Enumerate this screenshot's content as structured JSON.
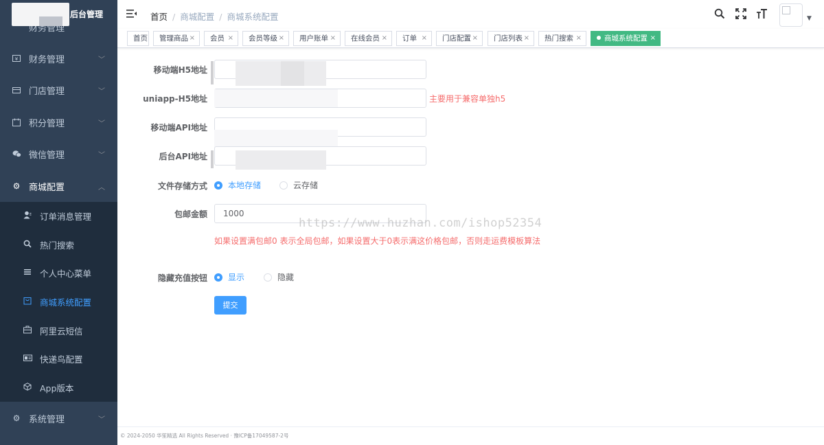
{
  "brand": {
    "title": "后台管理"
  },
  "sidebar": {
    "partial_item": "财务管理",
    "menus": [
      {
        "label": "财务管理",
        "icon": "finance-icon"
      },
      {
        "label": "门店管理",
        "icon": "store-icon"
      },
      {
        "label": "积分管理",
        "icon": "calendar-icon"
      },
      {
        "label": "微信管理",
        "icon": "wechat-icon"
      },
      {
        "label": "商城配置",
        "icon": "gear-icon"
      },
      {
        "label": "系统管理",
        "icon": "gear-icon"
      }
    ],
    "submenu": [
      {
        "label": "订单消息管理",
        "icon": "user-icon"
      },
      {
        "label": "热门搜索",
        "icon": "search-icon"
      },
      {
        "label": "个人中心菜单",
        "icon": "list-icon"
      },
      {
        "label": "商城系统配置",
        "icon": "cart-icon",
        "active": true
      },
      {
        "label": "阿里云短信",
        "icon": "briefcase-icon"
      },
      {
        "label": "快递鸟配置",
        "icon": "card-icon"
      },
      {
        "label": "App版本",
        "icon": "box-icon"
      }
    ]
  },
  "header": {
    "breadcrumb": [
      "首页",
      "商城配置",
      "商城系统配置"
    ]
  },
  "tags": [
    {
      "label": "首页",
      "closable": false
    },
    {
      "label": "管理商品",
      "closable": true
    },
    {
      "label": "会员",
      "closable": true
    },
    {
      "label": "会员等级",
      "closable": true
    },
    {
      "label": "用户账单",
      "closable": true
    },
    {
      "label": "在线会员",
      "closable": true
    },
    {
      "label": "订单",
      "closable": true
    },
    {
      "label": "门店配置",
      "closable": true
    },
    {
      "label": "门店列表",
      "closable": true
    },
    {
      "label": "热门搜索",
      "closable": true
    },
    {
      "label": "商城系统配置",
      "closable": true,
      "active": true
    }
  ],
  "tag_close_glyph": "×",
  "form": {
    "h5_label": "移动端H5地址",
    "uniapp_label": "uniapp-H5地址",
    "uniapp_hint": "主要用于兼容单独h5",
    "api_label": "移动端API地址",
    "admin_api_label": "后台API地址",
    "storage_label": "文件存储方式",
    "storage_options": [
      "本地存储",
      "云存储"
    ],
    "storage_selected": "本地存储",
    "shipping_label": "包邮金额",
    "shipping_value": "1000",
    "shipping_hint": "如果设置满包邮0 表示全局包邮，如果设置大于0表示满这价格包邮，否则走运费模板算法",
    "recharge_label": "隐藏充值按钮",
    "recharge_options": [
      "显示",
      "隐藏"
    ],
    "recharge_selected": "显示",
    "submit_label": "提交"
  },
  "watermark": "https://www.huzhan.com/ishop52354",
  "footer": {
    "text": "© 2024-2050 华笙精选 All Rights Reserved · 豫ICP备17049587-2号"
  },
  "colors": {
    "sidebar_bg": "#304156",
    "submenu_bg": "#1f2d3d",
    "accent": "#409eff",
    "active_tag": "#42b983",
    "hint_red": "#f56c6c"
  }
}
